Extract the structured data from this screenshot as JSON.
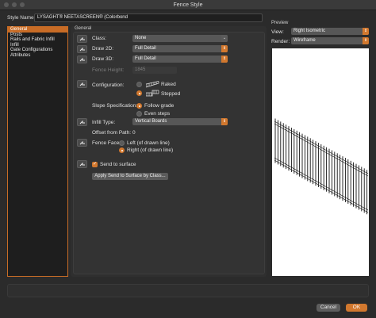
{
  "window": {
    "title": "Fence Style"
  },
  "style_name": {
    "label": "Style Name:",
    "value": "LYSAGHT® NEETASCREEN® (Colorbond"
  },
  "sidebar": {
    "items": [
      {
        "label": "General",
        "active": true
      },
      {
        "label": "Posts"
      },
      {
        "label": "Rails and Fabric Infill"
      },
      {
        "label": "Infill"
      },
      {
        "label": "Gate Configurations"
      },
      {
        "label": "Attributes"
      }
    ]
  },
  "general": {
    "section_title": "General",
    "class": {
      "label": "Class:",
      "value": "None"
    },
    "draw2d": {
      "label": "Draw 2D:",
      "value": "Full Detail"
    },
    "draw3d": {
      "label": "Draw 3D:",
      "value": "Full Detail"
    },
    "fence_height": {
      "label": "Fence Height:",
      "value": "1845"
    },
    "configuration": {
      "label": "Configuration:",
      "option1": "Raked",
      "option2": "Stepped",
      "selected": "Stepped"
    },
    "slope": {
      "label": "Slope Specification:",
      "option1": "Follow grade",
      "option2": "Even steps",
      "selected": "Follow grade"
    },
    "infill_type": {
      "label": "Infill Type:",
      "value": "Vertical Boards"
    },
    "offset": {
      "label": "Offset from Path:",
      "value": "0"
    },
    "fence_face": {
      "label": "Fence Face:",
      "option1": "Left (of drawn line)",
      "option2": "Right (of drawn line)",
      "selected": "Right (of drawn line)"
    },
    "send_to_surface": {
      "label": "Send to surface",
      "checked": true
    },
    "apply_button": "Apply Send to Surface by Class..."
  },
  "preview": {
    "title": "Preview",
    "view_label": "View:",
    "view_value": "Right Isometric",
    "render_label": "Render:",
    "render_value": "Wireframe"
  },
  "buttons": {
    "cancel": "Cancel",
    "ok": "OK"
  },
  "colors": {
    "accent": "#d2782e",
    "sidebar_border": "#c86c26"
  }
}
